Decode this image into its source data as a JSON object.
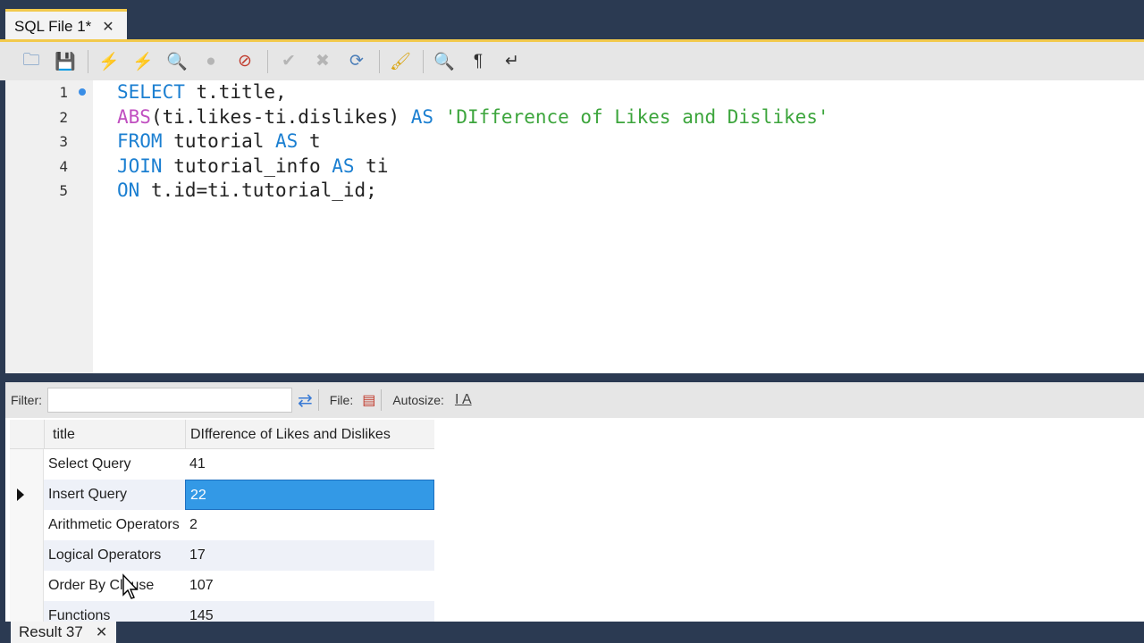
{
  "tabs": {
    "file_tab_label": "SQL File 1*",
    "close_glyph": "✕"
  },
  "toolbar": {
    "buttons": [
      {
        "name": "open-file-icon",
        "glyph": "🗀",
        "color": "#4a7db8"
      },
      {
        "name": "save-icon",
        "glyph": "💾",
        "color": "#4a7db8"
      },
      {
        "name": "execute-icon",
        "glyph": "⚡",
        "color": "#d9a513"
      },
      {
        "name": "execute-current-icon",
        "glyph": "⚡",
        "color": "#d9a513"
      },
      {
        "name": "explain-icon",
        "glyph": "🔍",
        "color": "#d9a513"
      },
      {
        "name": "stop-icon",
        "glyph": "●",
        "color": "#b5b5b5"
      },
      {
        "name": "stop-on-error-icon",
        "glyph": "⊘",
        "color": "#c0392b"
      },
      {
        "name": "commit-icon",
        "glyph": "✔",
        "color": "#b5b5b5"
      },
      {
        "name": "rollback-icon",
        "glyph": "✖",
        "color": "#b5b5b5"
      },
      {
        "name": "autocommit-icon",
        "glyph": "⟳",
        "color": "#4a7db8"
      },
      {
        "name": "beautify-icon",
        "glyph": "🖌",
        "color": "#d9a513"
      },
      {
        "name": "find-icon",
        "glyph": "🔍",
        "color": "#333333"
      },
      {
        "name": "invisible-chars-icon",
        "glyph": "¶",
        "color": "#333333"
      },
      {
        "name": "word-wrap-icon",
        "glyph": "↵",
        "color": "#333333"
      }
    ]
  },
  "editor": {
    "lines": [
      {
        "num": "1",
        "dot": true,
        "parts": [
          {
            "t": "SELECT",
            "c": "kw"
          },
          {
            "t": " t.title,",
            "c": ""
          }
        ]
      },
      {
        "num": "2",
        "dot": false,
        "parts": [
          {
            "t": "ABS",
            "c": "fn"
          },
          {
            "t": "(ti.likes-ti.dislikes) ",
            "c": ""
          },
          {
            "t": "AS",
            "c": "kw"
          },
          {
            "t": " ",
            "c": ""
          },
          {
            "t": "'DIfference of Likes and Dislikes'",
            "c": "str"
          }
        ]
      },
      {
        "num": "3",
        "dot": false,
        "parts": [
          {
            "t": "FROM",
            "c": "kw"
          },
          {
            "t": " tutorial ",
            "c": ""
          },
          {
            "t": "AS",
            "c": "kw"
          },
          {
            "t": " t",
            "c": ""
          }
        ]
      },
      {
        "num": "4",
        "dot": false,
        "parts": [
          {
            "t": "JOIN",
            "c": "kw"
          },
          {
            "t": " tutorial_info ",
            "c": ""
          },
          {
            "t": "AS",
            "c": "kw"
          },
          {
            "t": " ti",
            "c": ""
          }
        ]
      },
      {
        "num": "5",
        "dot": false,
        "parts": [
          {
            "t": "ON",
            "c": "kw"
          },
          {
            "t": " t.id=ti.tutorial_id;",
            "c": ""
          }
        ]
      }
    ]
  },
  "filterbar": {
    "filter_label": "Filter:",
    "filter_value": "",
    "file_label": "File:",
    "autosize_label": "Autosize:",
    "autosize_glyph": "I A"
  },
  "grid": {
    "columns": [
      "title",
      "DIfference of Likes and Dislikes"
    ],
    "rows": [
      {
        "title": "Select Query",
        "value": "41"
      },
      {
        "title": "Insert Query",
        "value": "22"
      },
      {
        "title": "Arithmetic Operators",
        "value": "2"
      },
      {
        "title": "Logical Operators",
        "value": "17"
      },
      {
        "title": "Order By Clause",
        "value": "107"
      },
      {
        "title": "Functions",
        "value": "145"
      }
    ],
    "selected_row": 1
  },
  "bottom": {
    "result_tab_label": "Result 37"
  }
}
